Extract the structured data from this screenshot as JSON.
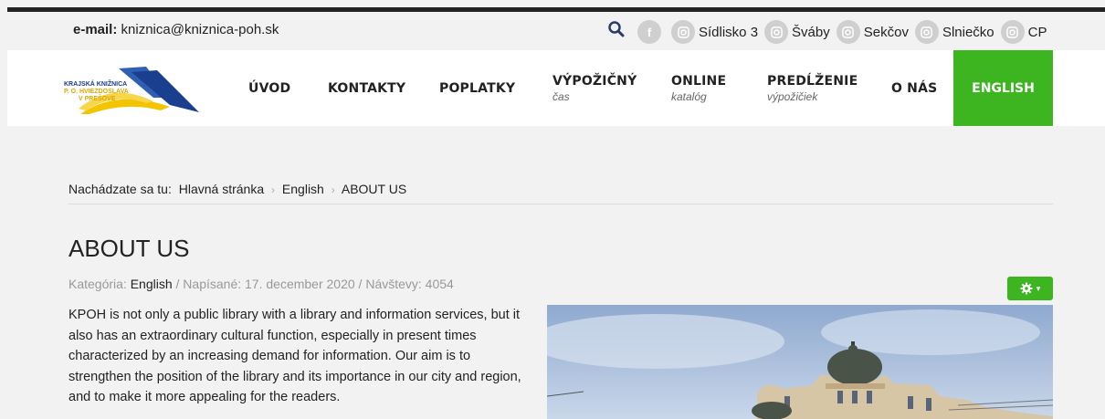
{
  "topbar": {
    "email_label": "e-mail:",
    "email_value": "kniznica@kniznica-poh.sk",
    "social": [
      {
        "icon": "facebook-icon",
        "label": ""
      },
      {
        "icon": "instagram-icon",
        "label": "Sídlisko 3"
      },
      {
        "icon": "instagram-icon",
        "label": "Šváby"
      },
      {
        "icon": "instagram-icon",
        "label": "Sekčov"
      },
      {
        "icon": "instagram-icon",
        "label": "Slniečko"
      },
      {
        "icon": "instagram-icon",
        "label": "CP"
      }
    ]
  },
  "logo": {
    "line1": "KRAJSKÁ KNIŽNICA",
    "line2": "P. O. HVIEZDOSLAVA",
    "line3": "V PREŠOVE"
  },
  "nav": {
    "uvod": "ÚVOD",
    "kontakty": "KONTAKTY",
    "poplatky": "POPLATKY",
    "vypozicny": "VÝPOŽIČNÝ",
    "vypozicny_sub": "čas",
    "online": "ONLINE",
    "online_sub": "katalóg",
    "predlzenie": "PREDĹŽENIE",
    "predlzenie_sub": "výpožičiek",
    "onas": "O NÁS",
    "english": "ENGLISH"
  },
  "breadcrumb": {
    "label": "Nachádzate sa tu:",
    "home": "Hlavná stránka",
    "sep": "›",
    "english": "English",
    "current": "ABOUT US"
  },
  "article": {
    "title": "ABOUT US",
    "category_label": "Kategória:",
    "category": "English",
    "written": "/ Napísané: 17. december 2020 / Návštevy: 4054",
    "text": "KPOH is not only a public library with a library and information services, but it also has an extraordinary cultural function, especially in present times characterized by an increasing demand for information. Our aim is to strengthen the position of the library and its importance in our city and region, and to make it more appealing for the readers."
  },
  "colors": {
    "accent": "#3cb521",
    "background": "#f2f2f2"
  }
}
